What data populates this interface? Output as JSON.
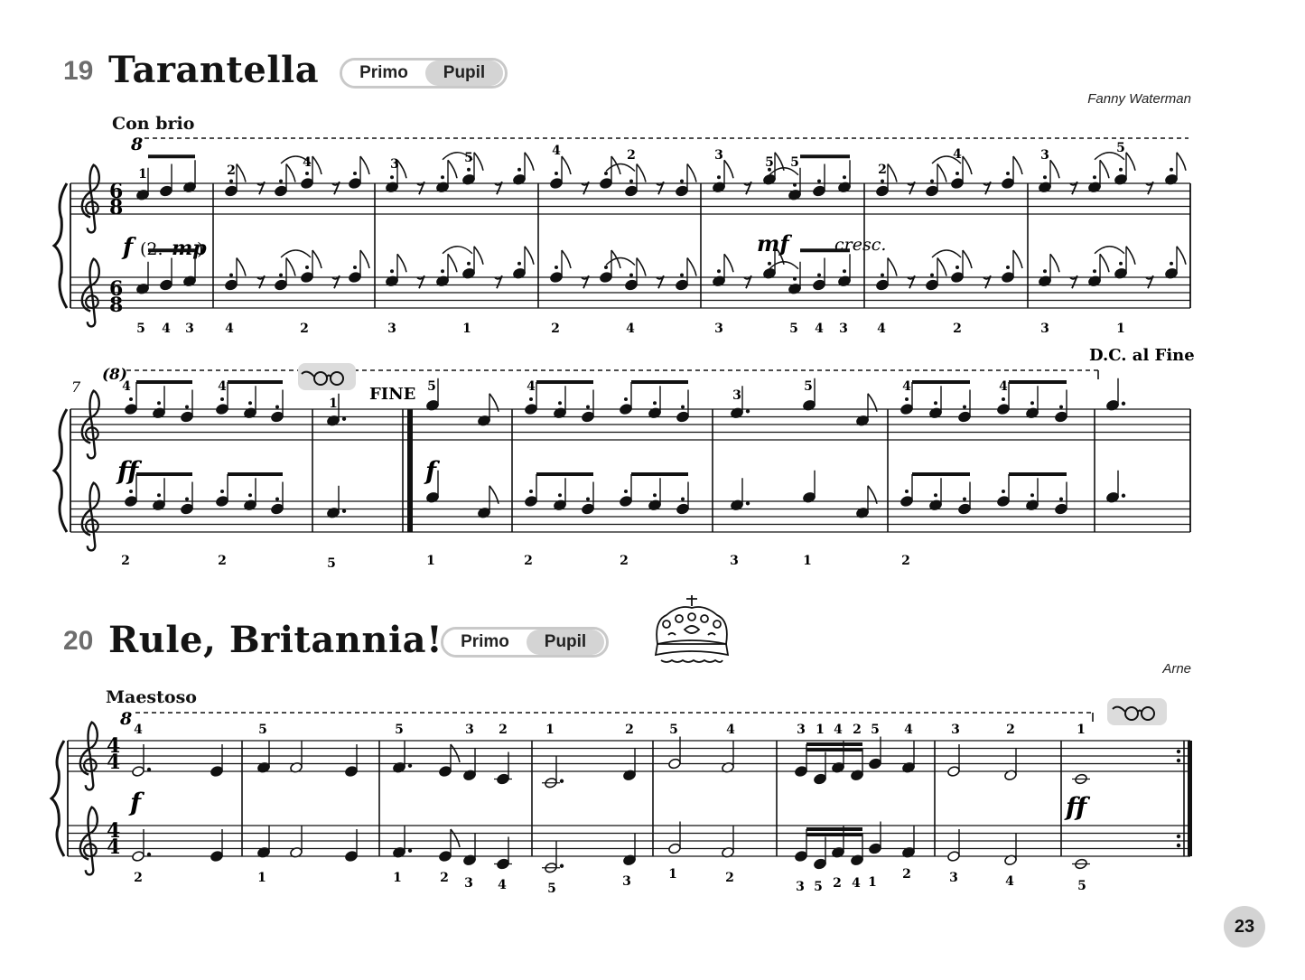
{
  "pieces": [
    {
      "number": "19",
      "title": "Tarantella",
      "toggle": {
        "primo": "Primo",
        "pupil": "Pupil"
      },
      "composer": "Fanny Waterman",
      "tempo": "Con brio",
      "octave_mark": "8",
      "octave_mark_repeat": "(8)",
      "dynamics": {
        "first": "f",
        "repeat": "(2.",
        "repeat_dyn": "mp",
        "repeat_close": ")",
        "mf": "mf",
        "cresc": "cresc.",
        "ff": "ff",
        "f": "f"
      },
      "measure_number_row2": "7",
      "fine_label": "FINE",
      "dc_label": "D.C. al Fine",
      "time_signature": [
        "6",
        "8"
      ],
      "row1_fingering_top": [
        "1",
        "2",
        "4",
        "3",
        "5",
        "4",
        "2",
        "3",
        "5",
        "5",
        "2",
        "4",
        "3",
        "5"
      ],
      "row1_fingering_bottom": [
        "5",
        "4",
        "3",
        "4",
        "2",
        "3",
        "1",
        "2",
        "4",
        "3",
        "5",
        "4",
        "3",
        "4",
        "2",
        "3",
        "1"
      ],
      "row2_fingering_top": [
        "4",
        "4",
        "1",
        "5",
        "4",
        "3",
        "5",
        "4",
        "4"
      ],
      "row2_fingering_bottom": [
        "2",
        "2",
        "5",
        "1",
        "2",
        "2",
        "3",
        "1",
        "2"
      ]
    },
    {
      "number": "20",
      "title": "Rule, Britannia!",
      "toggle": {
        "primo": "Primo",
        "pupil": "Pupil"
      },
      "composer": "Arne",
      "tempo": "Maestoso",
      "octave_mark": "8",
      "dynamics": {
        "f": "f",
        "ff": "ff"
      },
      "time_signature": [
        "4",
        "4"
      ],
      "fingering_top": [
        "4",
        "5",
        "5",
        "3",
        "2",
        "1",
        "2",
        "5",
        "4",
        "3",
        "1",
        "4",
        "2",
        "5",
        "4",
        "3",
        "2",
        "1"
      ],
      "fingering_bottom": [
        "2",
        "1",
        "1",
        "2",
        "3",
        "4",
        "5",
        "3",
        "1",
        "2",
        "3",
        "5",
        "2",
        "4",
        "1",
        "2",
        "3",
        "4",
        "5"
      ]
    }
  ],
  "icons": {
    "glasses": "glasses-icon",
    "crown": "crown-icon"
  },
  "page_number": "23"
}
